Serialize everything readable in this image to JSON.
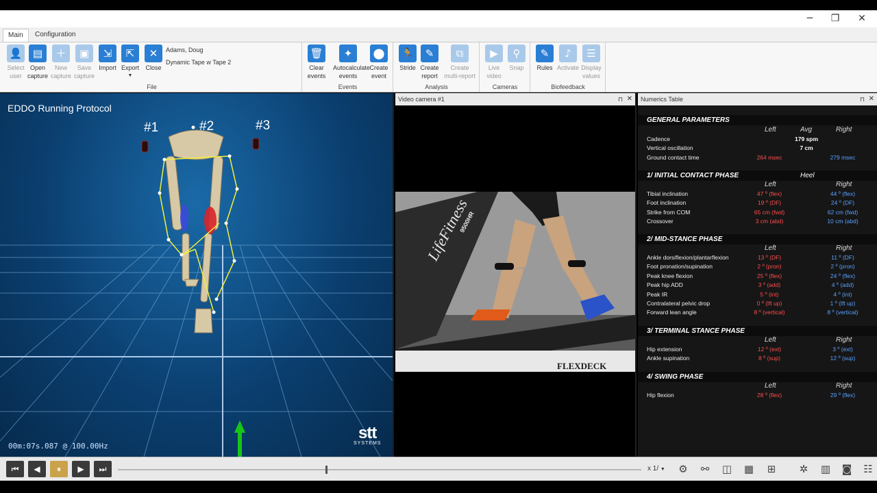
{
  "window": {
    "minimize_glyph": "─",
    "restore_glyph": "❐",
    "close_glyph": "✕"
  },
  "tabs": [
    {
      "label": "Main",
      "active": true
    },
    {
      "label": "Configuration",
      "active": false
    }
  ],
  "ribbon": {
    "user_name": "Adams, Doug",
    "capture_name": "Dynamic Tape w Tape 2",
    "groups": {
      "file": "File",
      "events": "Events",
      "analysis": "Analysis",
      "cameras": "Cameras",
      "biofeedback": "Biofeedback"
    },
    "buttons": {
      "select_user": "Select\nuser",
      "open_capture": "Open\ncapture",
      "new_capture": "New\ncapture",
      "save_capture": "Save\ncapture",
      "import": "Import",
      "export": "Export",
      "close": "Close",
      "clear_events": "Clear\nevents",
      "autocalculate_events": "Autocalculate\nevents",
      "create_event": "Create\nevent",
      "stride": "Stride",
      "create_report": "Create\nreport",
      "create_multi_report": "Create\nmulti-report",
      "live_video": "Live\nvideo",
      "snap": "Snap",
      "rules": "Rules",
      "activate": "Activate",
      "display_values": "Display\nvalues"
    }
  },
  "view3d": {
    "title": "EDDO Running Protocol",
    "markers": [
      "#1",
      "#2",
      "#3"
    ],
    "timecode": "00m:07s.087 @ 100.00Hz",
    "logo_main": "stt",
    "logo_sub": "SYSTEMS"
  },
  "video": {
    "panel_title": "Video camera #1",
    "treadmill_brand": "LifeFitness",
    "treadmill_model": "9500HR",
    "deck_label": "FLEXDECK"
  },
  "numerics": {
    "panel_title": "Numerics Table",
    "pin_glyph": "⊓",
    "close_glyph": "✕",
    "col_left": "Left",
    "col_avg": "Avg",
    "col_right": "Right",
    "sections": {
      "general": {
        "title": "GENERAL PARAMETERS",
        "rows": [
          {
            "name": "Cadence",
            "avg": "179 spm"
          },
          {
            "name": "Vertical oscillation",
            "avg": "7 cm"
          },
          {
            "name": "Ground contact time",
            "left": "264 msec",
            "right": "279 msec"
          }
        ]
      },
      "initial_contact": {
        "title": "1/ INITIAL CONTACT PHASE",
        "strike": "Heel",
        "rows": [
          {
            "name": "Tibial inclination",
            "left": "47 º (flex)",
            "right": "44 º (flex)"
          },
          {
            "name": "Foot inclination",
            "left": "19 º (DF)",
            "right": "24 º (DF)"
          },
          {
            "name": "Strike from COM",
            "left": "65 cm (fwd)",
            "right": "62 cm (fwd)"
          },
          {
            "name": "Crossover",
            "left": "3 cm (abd)",
            "right": "10 cm (abd)"
          }
        ]
      },
      "mid_stance": {
        "title": "2/ MID-STANCE PHASE",
        "rows": [
          {
            "name": "Ankle dorsiflexion/plantarflexion",
            "left": "13 º (DF)",
            "right": "11 º (DF)"
          },
          {
            "name": "Foot pronation/supination",
            "left": "2 º (pron)",
            "right": "2 º (pron)"
          },
          {
            "name": "Peak knee flexion",
            "left": "25 º (flex)",
            "right": "24 º (flex)"
          },
          {
            "name": "Peak hip ADD",
            "left": "3 º (add)",
            "right": "4 º (add)"
          },
          {
            "name": "Peak IR",
            "left": "5 º (int)",
            "right": "4 º (int)"
          },
          {
            "name": "Contralateral pelvic drop",
            "left": "0 º (lft up)",
            "right": "1 º (lft up)"
          },
          {
            "name": "Forward lean angle",
            "left": "8 º (vertical)",
            "right": "8 º (vertical)"
          }
        ]
      },
      "terminal_stance": {
        "title": "3/ TERMINAL STANCE PHASE",
        "rows": [
          {
            "name": "Hip extension",
            "left": "12 º (ext)",
            "right": "3 º (ext)"
          },
          {
            "name": "Ankle supination",
            "left": "8 º (sup)",
            "right": "12 º (sup)"
          }
        ]
      },
      "swing": {
        "title": "4/ SWING PHASE",
        "rows": [
          {
            "name": "Hip flexion",
            "left": "28 º (flex)",
            "right": "29 º (flex)"
          }
        ]
      }
    }
  },
  "playback": {
    "speed": "x 1/",
    "progress": 0.397,
    "buttons": {
      "first": "⏮",
      "prev": "◀",
      "pause": "⏸",
      "next": "▶",
      "last": "⏭"
    }
  },
  "colors": {
    "left_value": "#ff4d4d",
    "right_value": "#5aa0ff",
    "accent": "#2a7fd4"
  }
}
